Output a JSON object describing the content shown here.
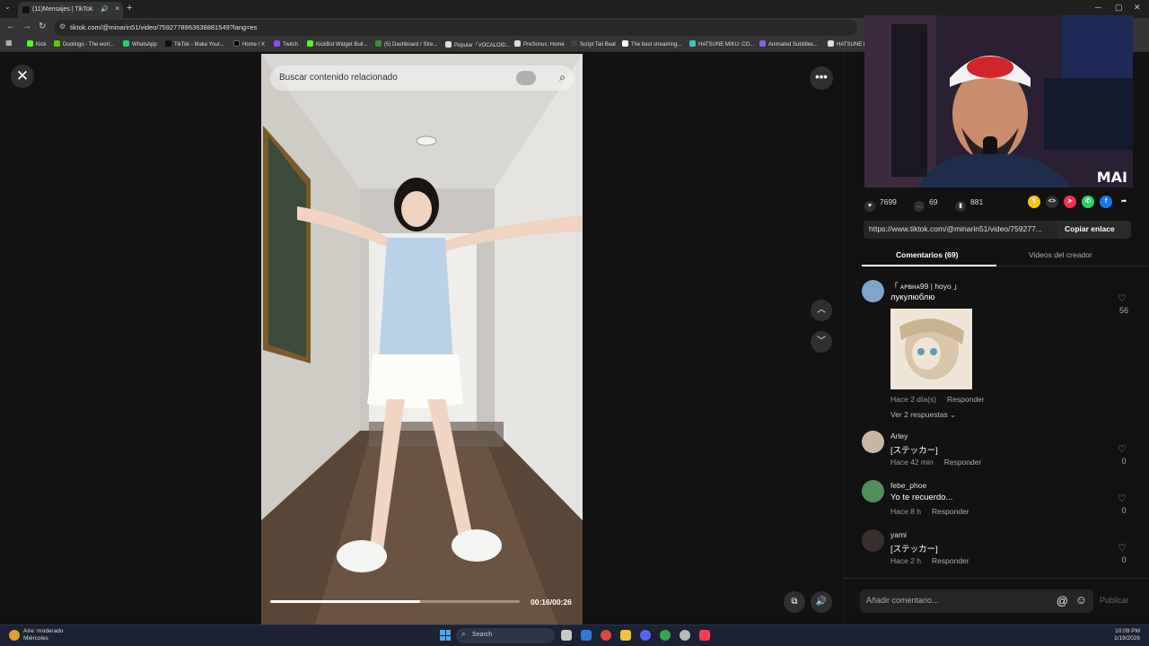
{
  "browser": {
    "tab_title": "(11)Mensajes | TikTok",
    "url": "tiktok.com/@minarin51/video/7592778963638881549?lang=es",
    "bookmarks": [
      {
        "label": "Kick",
        "color": "#53fc18"
      },
      {
        "label": "Duolingo - The worl...",
        "color": "#58cc02"
      },
      {
        "label": "WhatsApp",
        "color": "#25d366"
      },
      {
        "label": "TikTok - Make Your...",
        "color": "#111111"
      },
      {
        "label": "Home / X",
        "color": "#000000"
      },
      {
        "label": "Twitch",
        "color": "#9146ff"
      },
      {
        "label": "KickBot Widget Buil...",
        "color": "#53fc18"
      },
      {
        "label": "(5) Dashboard / Stre...",
        "color": "#3b8d3b"
      },
      {
        "label": "Popular「VOCALOID...",
        "color": "#dddddd"
      },
      {
        "label": "PreSonus: Home",
        "color": "#dddddd"
      },
      {
        "label": "Script Tail Beat",
        "color": "#444444"
      },
      {
        "label": "The best streaming...",
        "color": "#ffffff"
      },
      {
        "label": "HATSUNE MIKU: CO...",
        "color": "#39c5bb"
      },
      {
        "label": "Animated Subtitles...",
        "color": "#8a5cf6"
      },
      {
        "label": "HATSUNE MI...",
        "color": "#dddddd"
      }
    ]
  },
  "video": {
    "search_placeholder": "Buscar contenido relacionado",
    "time": "00:16/00:26",
    "progress": 0.6
  },
  "stats": {
    "likes": "7699",
    "comments": "69",
    "saves": "881"
  },
  "share_colors": [
    "#f5c518",
    "#2f2f2f",
    "#fe2c55",
    "#25d366",
    "#1877f2",
    "#2f2f2f"
  ],
  "link": {
    "url": "https://www.tiktok.com/@minarin51/video/759277...",
    "copy_label": "Copiar enlace"
  },
  "tabs": {
    "comments": "Comentarios (69)",
    "creator": "Videos del creador"
  },
  "webcam": {
    "watermark": "MAI"
  },
  "comments": [
    {
      "user": "「 ᴀᴘвнᴀ99 | hoyo 」",
      "text": "лукулюблю",
      "time": "Hace 2 día(s)",
      "reply": "Responder",
      "likes": "56",
      "replies": "Ver 2 respuestas",
      "avatar": "#7fa5c9"
    },
    {
      "user": "Arley",
      "text": "[ステッカー]",
      "time": "Hace 42 min",
      "reply": "Responder",
      "likes": "0",
      "avatar": "#c7b8a6"
    },
    {
      "user": "febe_phoe",
      "text": "Yo te recuerdo...",
      "time": "Hace 8 h",
      "reply": "Responder",
      "likes": "0",
      "avatar": "#4f8f5a"
    },
    {
      "user": "yami",
      "text": "[ステッカー]",
      "time": "Hace 2 h",
      "reply": "Responder",
      "likes": "0",
      "avatar": "#3a2e2e"
    }
  ],
  "comment_input": {
    "placeholder": "Añadir comentario...",
    "publish": "Publicar"
  },
  "taskbar": {
    "weather_title": "Aire: moderado",
    "weather_sub": "Miércoles",
    "search": "Search",
    "time": "10:09 PM",
    "date": "1/19/2026"
  }
}
